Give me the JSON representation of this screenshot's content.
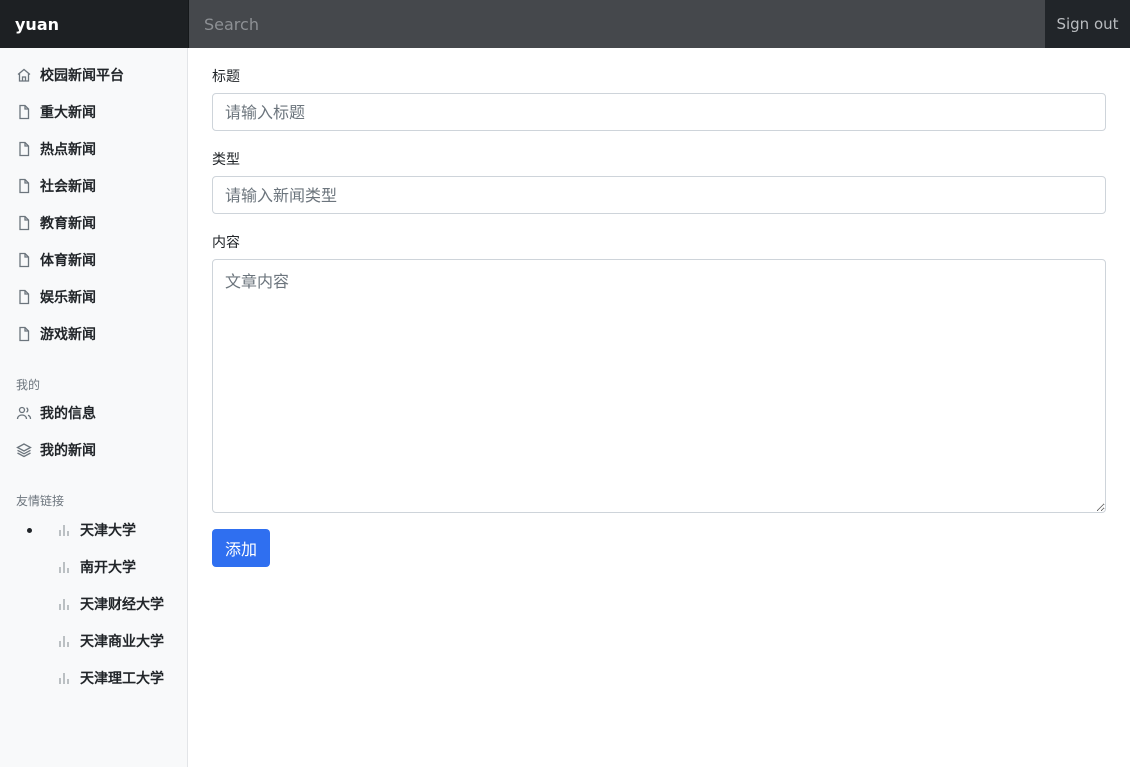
{
  "navbar": {
    "brand": "yuan",
    "search_placeholder": "Search",
    "signout_label": "Sign out"
  },
  "sidebar": {
    "items": [
      {
        "label": "校园新闻平台",
        "icon": "home-icon"
      },
      {
        "label": "重大新闻",
        "icon": "file-icon"
      },
      {
        "label": "热点新闻",
        "icon": "file-icon"
      },
      {
        "label": "社会新闻",
        "icon": "file-icon"
      },
      {
        "label": "教育新闻",
        "icon": "file-icon"
      },
      {
        "label": "体育新闻",
        "icon": "file-icon"
      },
      {
        "label": "娱乐新闻",
        "icon": "file-icon"
      },
      {
        "label": "游戏新闻",
        "icon": "file-icon"
      }
    ],
    "mine_heading": "我的",
    "mine_items": [
      {
        "label": "我的信息",
        "icon": "users-icon"
      },
      {
        "label": "我的新闻",
        "icon": "layers-icon"
      }
    ],
    "links_heading": "友情链接",
    "links": [
      {
        "label": "天津大学",
        "icon": "bar-chart-icon"
      },
      {
        "label": "南开大学",
        "icon": "bar-chart-icon"
      },
      {
        "label": "天津财经大学",
        "icon": "bar-chart-icon"
      },
      {
        "label": "天津商业大学",
        "icon": "bar-chart-icon"
      },
      {
        "label": "天津理工大学",
        "icon": "bar-chart-icon"
      }
    ]
  },
  "form": {
    "title_label": "标题",
    "title_placeholder": "请输入标题",
    "type_label": "类型",
    "type_placeholder": "请输入新闻类型",
    "content_label": "内容",
    "content_placeholder": "文章内容",
    "submit_label": "添加"
  },
  "colors": {
    "navbar": "#212529",
    "search_bg": "#45484c",
    "sidebar_bg": "#f8f9fa",
    "primary": "#2f6ff0"
  }
}
